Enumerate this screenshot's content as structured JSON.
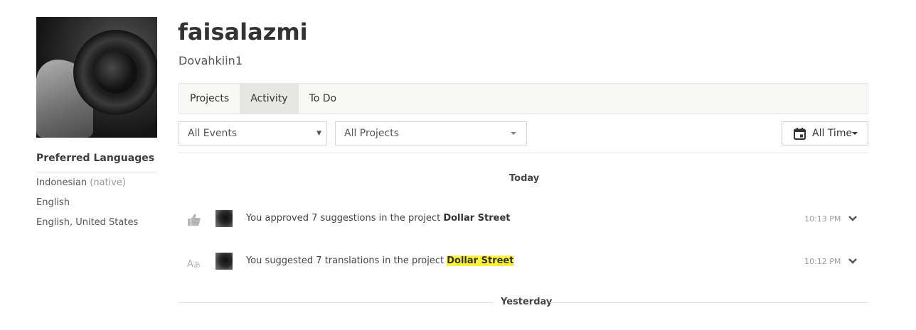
{
  "profile": {
    "username": "faisalazmi",
    "display_name": "Dovahkiin1"
  },
  "preferred_languages": {
    "title": "Preferred Languages",
    "items": [
      {
        "name": "Indonesian",
        "note": "(native)"
      },
      {
        "name": "English",
        "note": ""
      },
      {
        "name": "English, United States",
        "note": ""
      }
    ]
  },
  "tabs": [
    {
      "label": "Projects",
      "active": false
    },
    {
      "label": "Activity",
      "active": true
    },
    {
      "label": "To Do",
      "active": false
    }
  ],
  "filters": {
    "events_selected": "All Events",
    "projects_selected": "All Projects",
    "time_selected": "All Time"
  },
  "timeline": {
    "today_label": "Today",
    "yesterday_label": "Yesterday",
    "events": [
      {
        "icon": "thumbs-up-icon",
        "prefix": "You approved 7 suggestions in the project",
        "project": "Dollar Street",
        "highlighted": false,
        "time": "10:13 PM"
      },
      {
        "icon": "translate-icon",
        "prefix": "You suggested 7 translations in the project",
        "project": "Dollar Street",
        "highlighted": true,
        "time": "10:12 PM"
      }
    ]
  },
  "colors": {
    "highlight": "#fff23a",
    "active_tab": "#e6e6e4",
    "tab_bar": "#f8f8f6"
  }
}
